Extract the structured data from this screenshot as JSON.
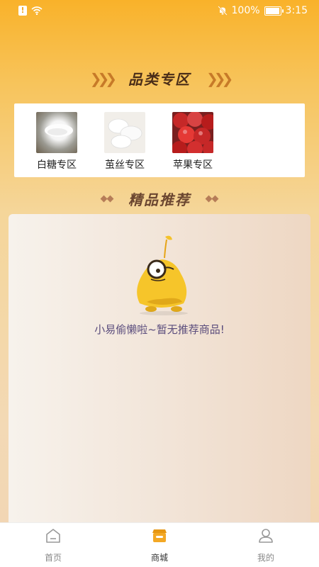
{
  "status": {
    "battery": "100%",
    "time": "3:15"
  },
  "sections": {
    "category_title": "品类专区",
    "recommend_title": "精品推荐"
  },
  "categories": [
    {
      "label": "白糖专区",
      "icon": "sugar-image"
    },
    {
      "label": "茧丝专区",
      "icon": "cocoon-image"
    },
    {
      "label": "苹果专区",
      "icon": "apple-image"
    }
  ],
  "empty_state": {
    "message": "小易偷懒啦~暂无推荐商品!"
  },
  "nav": [
    {
      "label": "首页",
      "icon": "home-icon"
    },
    {
      "label": "商城",
      "icon": "shop-icon"
    },
    {
      "label": "我的",
      "icon": "user-icon"
    }
  ],
  "colors": {
    "accent": "#f3a825",
    "title": "#4a2d18",
    "empty_text": "#5a4c7c"
  }
}
